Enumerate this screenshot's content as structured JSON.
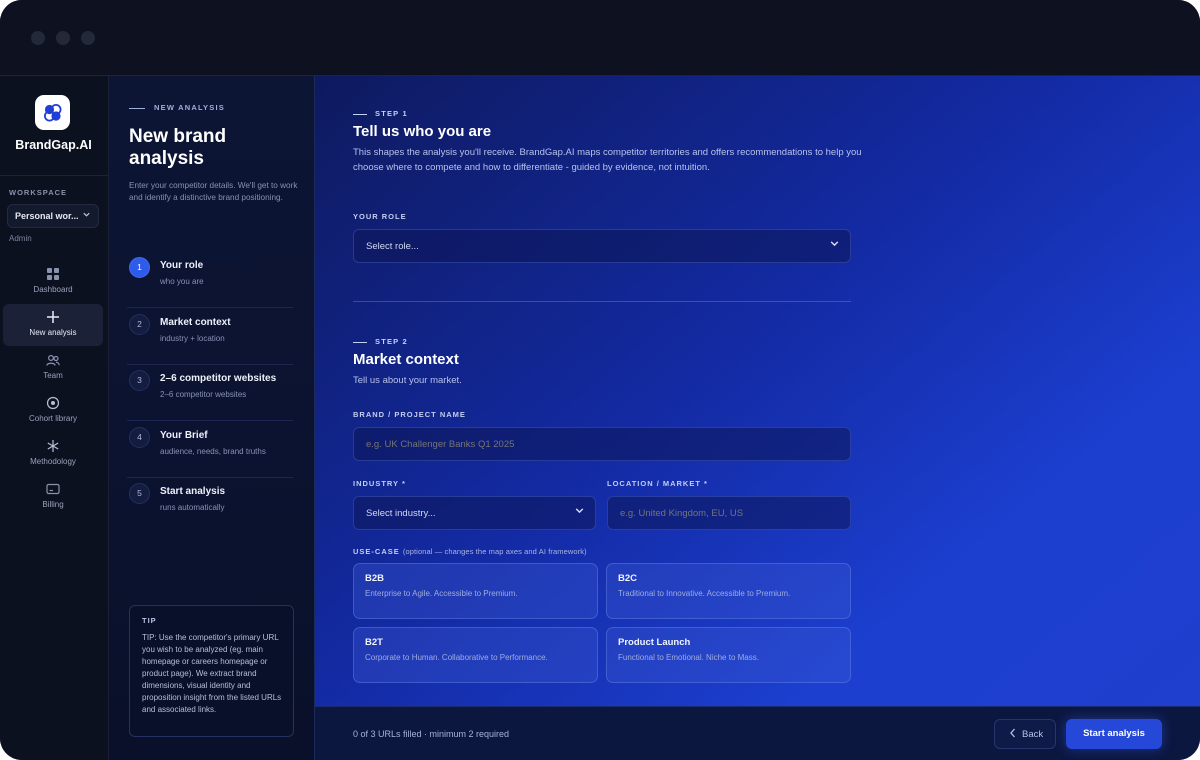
{
  "app": {
    "name": "BrandGap.AI"
  },
  "sidebar": {
    "workspace_label": "WORKSPACE",
    "workspace_value": "Personal wor...",
    "workspace_role": "Admin",
    "items": [
      {
        "label": "Dashboard",
        "icon": "dashboard-icon"
      },
      {
        "label": "New analysis",
        "icon": "plus-icon",
        "active": true
      },
      {
        "label": "Team",
        "icon": "team-icon"
      },
      {
        "label": "Cohort library",
        "icon": "target-icon"
      },
      {
        "label": "Methodology",
        "icon": "asterisk-icon"
      },
      {
        "label": "Billing",
        "icon": "card-icon"
      }
    ]
  },
  "steps_panel": {
    "eyebrow": "NEW ANALYSIS",
    "title": "New brand analysis",
    "description": "Enter your competitor details. We'll get to work and identify a distinctive brand positioning.",
    "steps": [
      {
        "number": "1",
        "title": "Your role",
        "subtitle": "who you are",
        "active": true
      },
      {
        "number": "2",
        "title": "Market context",
        "subtitle": "industry + location"
      },
      {
        "number": "3",
        "title": "2–6 competitor websites",
        "subtitle": "2–6 competitor websites"
      },
      {
        "number": "4",
        "title": "Your Brief",
        "subtitle": "audience, needs, brand truths"
      },
      {
        "number": "5",
        "title": "Start analysis",
        "subtitle": "runs automatically"
      }
    ],
    "tip": {
      "label": "TIP",
      "text": "TIP: Use the competitor's primary URL you wish to be analyzed (eg. main homepage or careers homepage or product page). We extract brand dimensions, visual identity and proposition insight from the listed URLs and associated links."
    }
  },
  "step1": {
    "eyebrow": "STEP 1",
    "title": "Tell us who you are",
    "description": "This shapes the analysis you'll receive. BrandGap.AI maps competitor territories and offers recommendations to help you choose where to compete and how to differentiate - guided by evidence, not intuition.",
    "role_label": "YOUR ROLE",
    "role_value": "Select role..."
  },
  "step2": {
    "eyebrow": "STEP 2",
    "title": "Market context",
    "description": "Tell us about your market.",
    "project_label": "BRAND / PROJECT NAME",
    "project_placeholder": "e.g. UK Challenger Banks Q1 2025",
    "industry_label": "INDUSTRY *",
    "industry_value": "Select industry...",
    "location_label": "LOCATION / MARKET *",
    "location_placeholder": "e.g. United Kingdom, EU, US",
    "usecase_label": "USE-CASE",
    "usecase_hint": "(optional — changes the map axes and AI framework)",
    "usecases": [
      {
        "title": "B2B",
        "subtitle": "Enterprise to Agile. Accessible to Premium."
      },
      {
        "title": "B2C",
        "subtitle": "Traditional to Innovative. Accessible to Premium."
      },
      {
        "title": "B2T",
        "subtitle": "Corporate to Human. Collaborative to Performance."
      },
      {
        "title": "Product Launch",
        "subtitle": "Functional to Emotional. Niche to Mass."
      }
    ]
  },
  "footer": {
    "status": "0 of 3 URLs filled · minimum 2 required",
    "back_label": "Back",
    "start_label": "Start analysis"
  },
  "colors": {
    "accent": "#2548d8",
    "step_active": "#2f5bea",
    "background": "#0b1024"
  }
}
